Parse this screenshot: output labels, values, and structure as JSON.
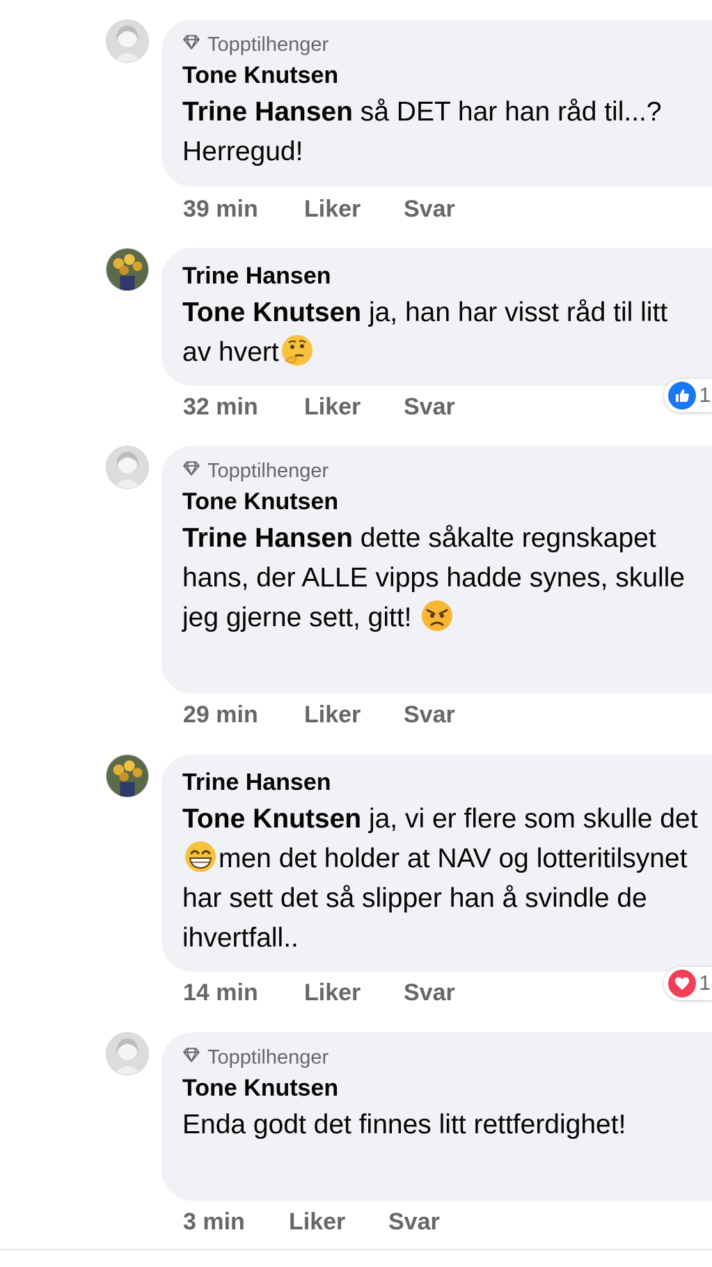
{
  "comments": [
    {
      "badge": "Topptilhenger",
      "author": "Tone Knutsen",
      "mention": "Trine Hansen",
      "text": " så DET har han råd til...? Herregud!",
      "time": "39 min",
      "like": "Liker",
      "reply": "Svar"
    },
    {
      "author": "Trine Hansen",
      "mention": "Tone Knutsen",
      "text": " ja, han har visst råd til litt av hvert",
      "emoji": "thinking-face",
      "time": "32 min",
      "like": "Liker",
      "reply": "Svar",
      "reaction": {
        "icon": "like-reaction-icon",
        "count": "1"
      }
    },
    {
      "badge": "Topptilhenger",
      "author": "Tone Knutsen",
      "mention": "Trine Hansen",
      "text": " dette såkalte regnskapet hans, der ALLE vipps hadde synes, skulle jeg gjerne sett, gitt! ",
      "emoji": "angry-face",
      "time": "29 min",
      "like": "Liker",
      "reply": "Svar"
    },
    {
      "author": "Trine Hansen",
      "mention": "Tone Knutsen",
      "text_before": " ja, vi er flere som skulle det",
      "emoji": "grinning-face",
      "text_after": "men det holder at NAV og lotteritilsynet har sett det så slipper han å svindle de ihvertfall..",
      "time": "14 min",
      "like": "Liker",
      "reply": "Svar",
      "reaction": {
        "icon": "love-reaction-icon",
        "count": "1"
      }
    },
    {
      "badge": "Topptilhenger",
      "author": "Tone Knutsen",
      "text": "Enda godt det finnes litt rettferdighet!",
      "time": "3 min",
      "like": "Liker",
      "reply": "Svar"
    }
  ],
  "colors": {
    "bubble": "#f0f2f5",
    "meta": "#65676b",
    "like_blue": "#1877f2",
    "love_red": "#f33e58"
  }
}
